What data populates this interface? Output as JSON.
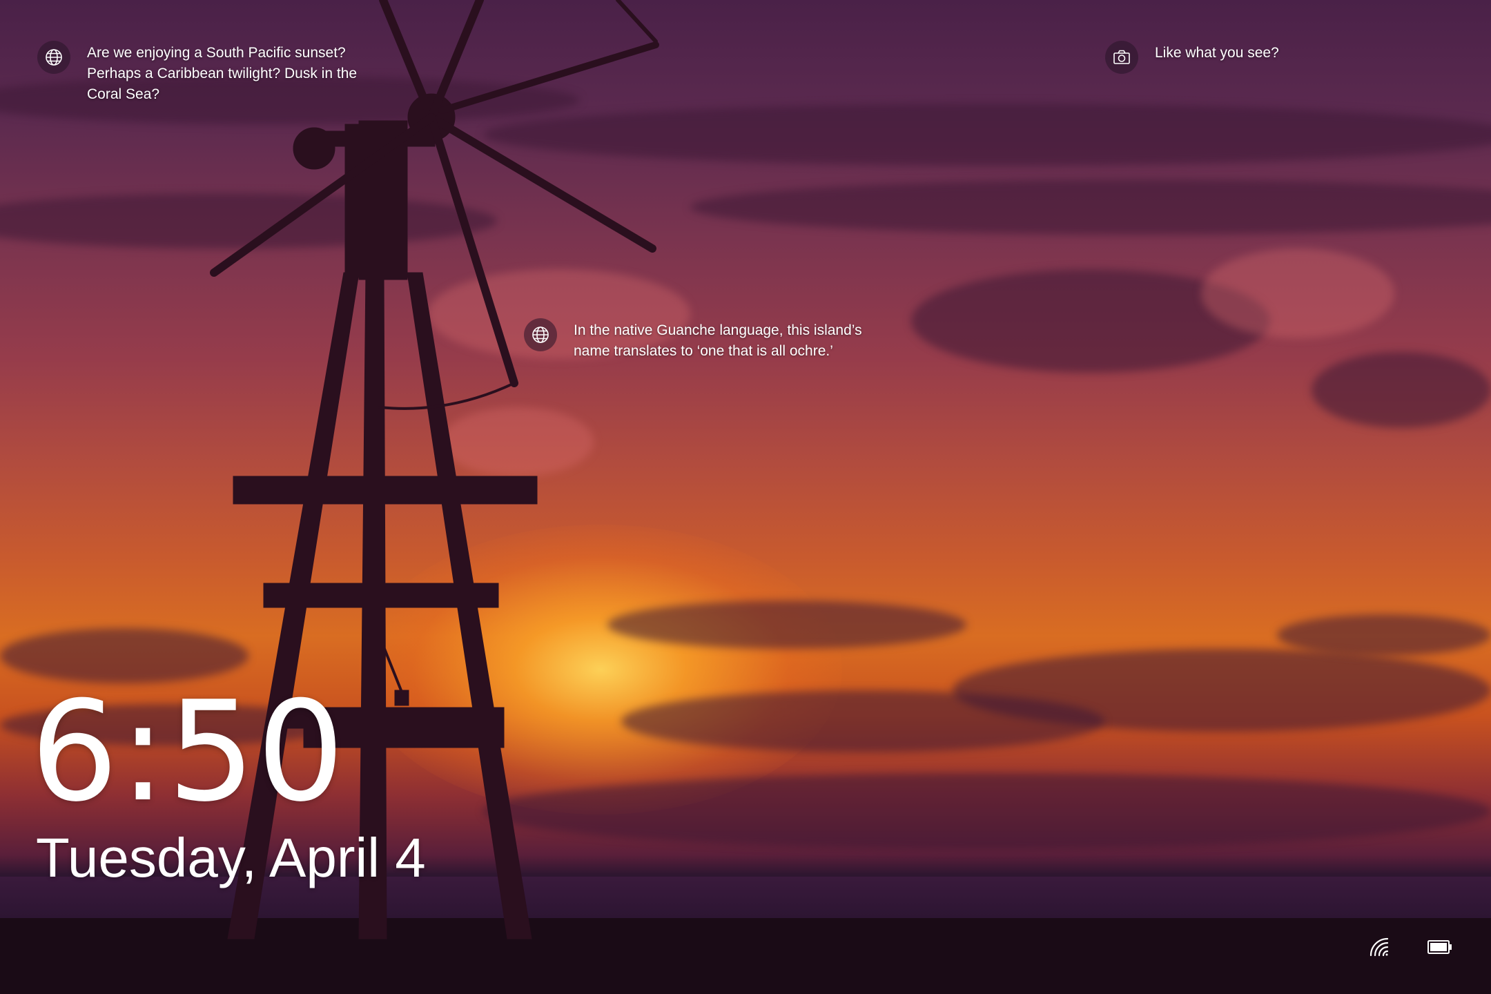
{
  "background": {
    "description_colors": {
      "sky_top": "#4a2148",
      "sky_mid": "#b04b3f",
      "sun": "#ffd65a",
      "horizon": "#2e1630"
    }
  },
  "spotlight": {
    "hotspot_1": {
      "icon": "globe-icon",
      "text": "Are we enjoying a South Pacific sunset? Perhaps a Caribbean twilight? Dusk in the Coral Sea?"
    },
    "hotspot_2": {
      "icon": "globe-icon",
      "text": "In the native Guanche language, this island’s name translates to ‘one that is all ochre.’"
    },
    "like_prompt": {
      "icon": "camera-icon",
      "text": "Like what you see?"
    }
  },
  "clock": {
    "time": "6:50",
    "date": "Tuesday, April 4"
  },
  "status": {
    "network_icon": "wifi-icon",
    "battery_icon": "battery-icon"
  }
}
